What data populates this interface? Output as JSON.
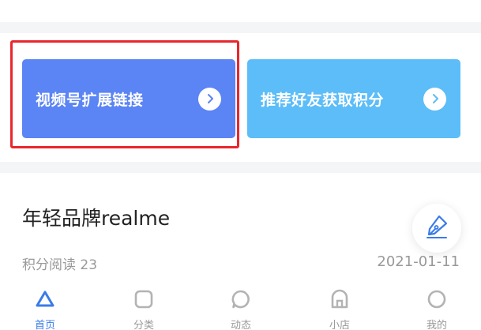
{
  "promos": [
    {
      "label": "视频号扩展链接",
      "color": "#5b84f4",
      "highlighted": true,
      "icon": "chevron-right-icon"
    },
    {
      "label": "推荐好友获取积分",
      "color": "#5cbdf8",
      "highlighted": false,
      "icon": "chevron-right-icon"
    }
  ],
  "highlight_color": "#e8262c",
  "article": {
    "title": "年轻品牌realme",
    "meta": "积分阅读 23",
    "date": "2021-01-11",
    "fab_icon": "pen-nib-icon"
  },
  "tabs": [
    {
      "label": "首页",
      "icon": "triangle-icon",
      "active": true
    },
    {
      "label": "分类",
      "icon": "square-icon",
      "active": false
    },
    {
      "label": "动态",
      "icon": "chat-bubble-icon",
      "active": false
    },
    {
      "label": "小店",
      "icon": "shop-icon",
      "active": false
    },
    {
      "label": "我的",
      "icon": "circle-icon",
      "active": false
    }
  ],
  "accent_color": "#3a7be8"
}
